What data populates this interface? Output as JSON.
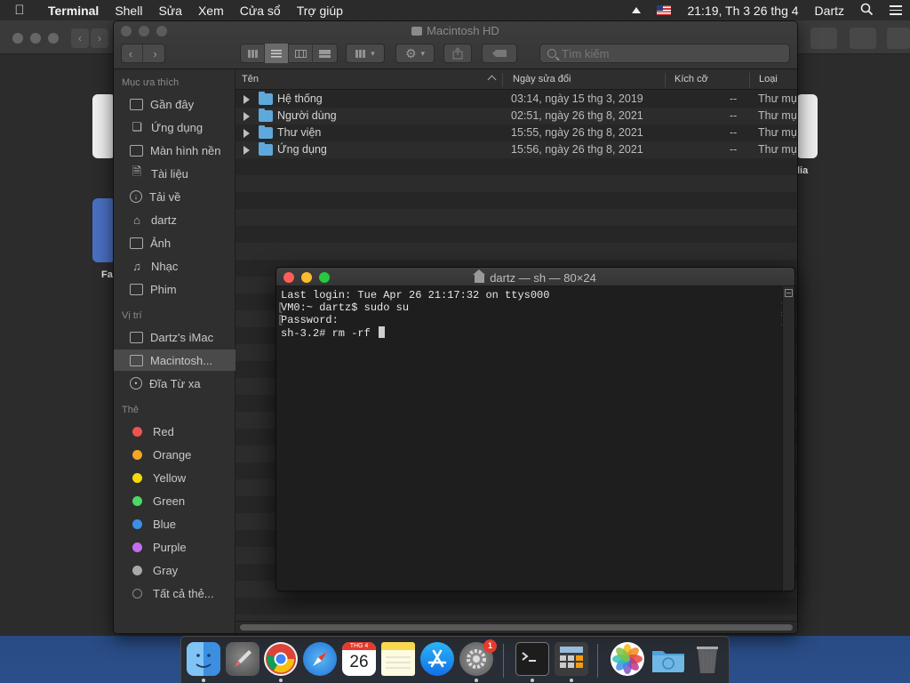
{
  "menubar": {
    "app_name": "Terminal",
    "items": [
      "Shell",
      "Sửa",
      "Xem",
      "Cửa sổ",
      "Trợ giúp"
    ],
    "clock": "21:19, Th 3 26 thg 4",
    "user": "Dartz"
  },
  "finder": {
    "title": "Macintosh HD",
    "search_placeholder": "Tìm kiếm",
    "sidebar": {
      "favorites_header": "Mục ưa thích",
      "favorites": [
        {
          "label": "Gần đây",
          "icon": "recents-icon"
        },
        {
          "label": "Ứng dụng",
          "icon": "applications-icon"
        },
        {
          "label": "Màn hình nền",
          "icon": "desktop-icon"
        },
        {
          "label": "Tài liệu",
          "icon": "documents-icon"
        },
        {
          "label": "Tải về",
          "icon": "downloads-icon"
        },
        {
          "label": "dartz",
          "icon": "home-icon"
        },
        {
          "label": "Ảnh",
          "icon": "camera-icon"
        },
        {
          "label": "Nhạc",
          "icon": "music-icon"
        },
        {
          "label": "Phim",
          "icon": "film-icon"
        }
      ],
      "locations_header": "Vị trí",
      "locations": [
        {
          "label": "Dartz's iMac",
          "icon": "imac-icon"
        },
        {
          "label": "Macintosh...",
          "icon": "hard-disk-icon",
          "selected": true
        },
        {
          "label": "Đĩa Từ xa",
          "icon": "remote-disc-icon"
        }
      ],
      "tags_header": "Thẻ",
      "tags": [
        {
          "label": "Red",
          "color": "#ef5350"
        },
        {
          "label": "Orange",
          "color": "#f5a623"
        },
        {
          "label": "Yellow",
          "color": "#f5d90a"
        },
        {
          "label": "Green",
          "color": "#4cd964"
        },
        {
          "label": "Blue",
          "color": "#3b8fe8"
        },
        {
          "label": "Purple",
          "color": "#c36df0"
        },
        {
          "label": "Gray",
          "color": "#a8a8a8"
        },
        {
          "label": "Tất cả thẻ...",
          "color": "all"
        }
      ]
    },
    "columns": {
      "name": "Tên",
      "modified": "Ngày sửa đổi",
      "size": "Kích cỡ",
      "kind": "Loại"
    },
    "files": [
      {
        "name": "Hệ thống",
        "modified": "03:14, ngày 15 thg 3, 2019",
        "size": "--",
        "kind": "Thư mục"
      },
      {
        "name": "Người dùng",
        "modified": "02:51, ngày 26 thg 8, 2021",
        "size": "--",
        "kind": "Thư mục"
      },
      {
        "name": "Thư viện",
        "modified": "15:55, ngày 26 thg 8, 2021",
        "size": "--",
        "kind": "Thư mục"
      },
      {
        "name": "Ứng dụng",
        "modified": "15:56, ngày 26 thg 8, 2021",
        "size": "--",
        "kind": "Thư mục"
      }
    ]
  },
  "terminal": {
    "title": "dartz — sh — 80×24",
    "lines": [
      "Last login: Tue Apr 26 21:17:32 on ttys000",
      "VM0:~ dartz$ sudo su",
      "Password:",
      "sh-3.2# rm -rf "
    ]
  },
  "background": {
    "label_left_1": "F",
    "label_left_2": "Fa",
    "label_right": "lia"
  },
  "dock": {
    "calendar_month": "THG 4",
    "calendar_day": "26",
    "app_store_badge": "1",
    "apps": [
      "finder-icon",
      "launchpad-icon",
      "chrome-icon",
      "safari-icon",
      "calendar-icon",
      "notes-icon",
      "app-store-icon",
      "system-preferences-icon",
      "terminal-icon",
      "calculator-icon",
      "photos-icon",
      "downloads-folder-icon",
      "trash-icon"
    ]
  }
}
